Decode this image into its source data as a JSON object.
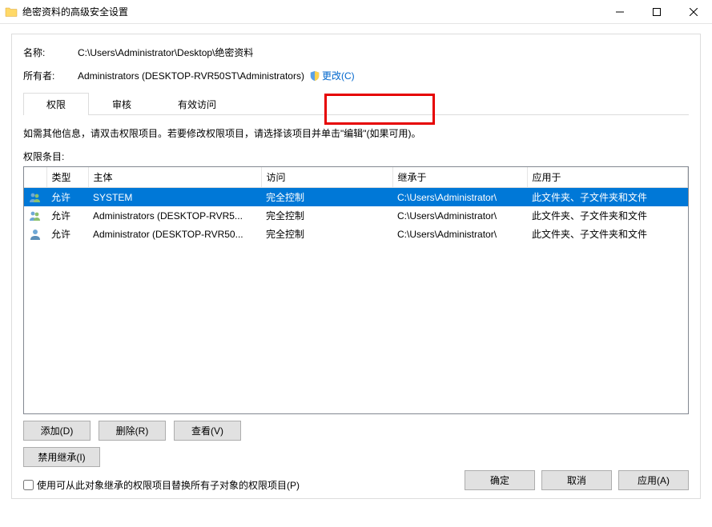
{
  "window": {
    "title": "绝密资料的高级安全设置"
  },
  "labels": {
    "name": "名称:",
    "owner": "所有者:"
  },
  "values": {
    "name_path": "C:\\Users\\Administrator\\Desktop\\绝密资料",
    "owner_text": "Administrators (DESKTOP-RVR50ST\\Administrators)",
    "change_link": "更改(C)"
  },
  "tabs": {
    "permissions": "权限",
    "auditing": "审核",
    "effective": "有效访问"
  },
  "info_text": "如需其他信息，请双击权限项目。若要修改权限项目，请选择该项目并单击\"编辑\"(如果可用)。",
  "entries_label": "权限条目:",
  "columns": {
    "type": "类型",
    "principal": "主体",
    "access": "访问",
    "inherited": "继承于",
    "applies": "应用于"
  },
  "rows": [
    {
      "icon": "group",
      "type": "允许",
      "principal": "SYSTEM",
      "access": "完全控制",
      "inherited": "C:\\Users\\Administrator\\",
      "applies": "此文件夹、子文件夹和文件",
      "selected": true
    },
    {
      "icon": "group",
      "type": "允许",
      "principal": "Administrators (DESKTOP-RVR5...",
      "access": "完全控制",
      "inherited": "C:\\Users\\Administrator\\",
      "applies": "此文件夹、子文件夹和文件",
      "selected": false
    },
    {
      "icon": "user",
      "type": "允许",
      "principal": "Administrator (DESKTOP-RVR50...",
      "access": "完全控制",
      "inherited": "C:\\Users\\Administrator\\",
      "applies": "此文件夹、子文件夹和文件",
      "selected": false
    }
  ],
  "buttons": {
    "add": "添加(D)",
    "remove": "删除(R)",
    "view": "查看(V)",
    "disable_inherit": "禁用继承(I)"
  },
  "checkbox": {
    "replace_label": "使用可从此对象继承的权限项目替换所有子对象的权限项目(P)"
  },
  "footer": {
    "ok": "确定",
    "cancel": "取消",
    "apply": "应用(A)"
  }
}
